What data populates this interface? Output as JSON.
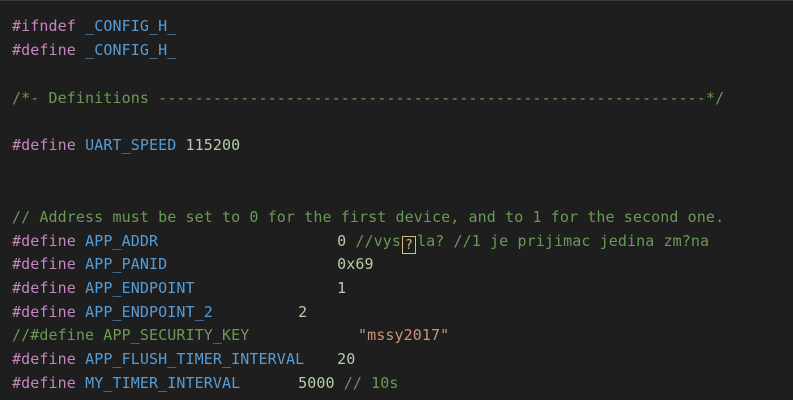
{
  "editor": {
    "language": "c",
    "colors": {
      "background": "#1e1e1e",
      "preprocessor": "#c586c0",
      "macro_name": "#569cd6",
      "number": "#b5cea8",
      "string": "#ce9178",
      "comment": "#6a9955"
    },
    "lines": {
      "l1": {
        "directive": "#ifndef",
        "name": "_CONFIG_H_"
      },
      "l2": {
        "directive": "#define",
        "name": "_CONFIG_H_"
      },
      "l4": {
        "comment": "/*- Definitions ------------------------------------------------------------*/"
      },
      "l6": {
        "directive": "#define",
        "name": "UART_SPEED",
        "value": "115200"
      },
      "l9": {
        "comment": "// Address must be set to 0 for the first device, and to 1 for the second one."
      },
      "l10": {
        "directive": "#define",
        "name": "APP_ADDR",
        "value": "0",
        "comment_before": "//vys",
        "bad_char": "?",
        "comment_after": "la? //1 je prijimac jedina zm?na"
      },
      "l11": {
        "directive": "#define",
        "name": "APP_PANID",
        "value": "0x69"
      },
      "l12": {
        "directive": "#define",
        "name": "APP_ENDPOINT",
        "value": "1"
      },
      "l13": {
        "directive": "#define",
        "name": "APP_ENDPOINT_2",
        "value": "2"
      },
      "l14": {
        "comment": "//#define APP_SECURITY_KEY",
        "value": "\"mssy2017\""
      },
      "l15": {
        "directive": "#define",
        "name": "APP_FLUSH_TIMER_INTERVAL",
        "value": "20"
      },
      "l16": {
        "directive": "#define",
        "name": "MY_TIMER_INTERVAL",
        "value": "5000",
        "comment": "// 10s"
      }
    }
  }
}
